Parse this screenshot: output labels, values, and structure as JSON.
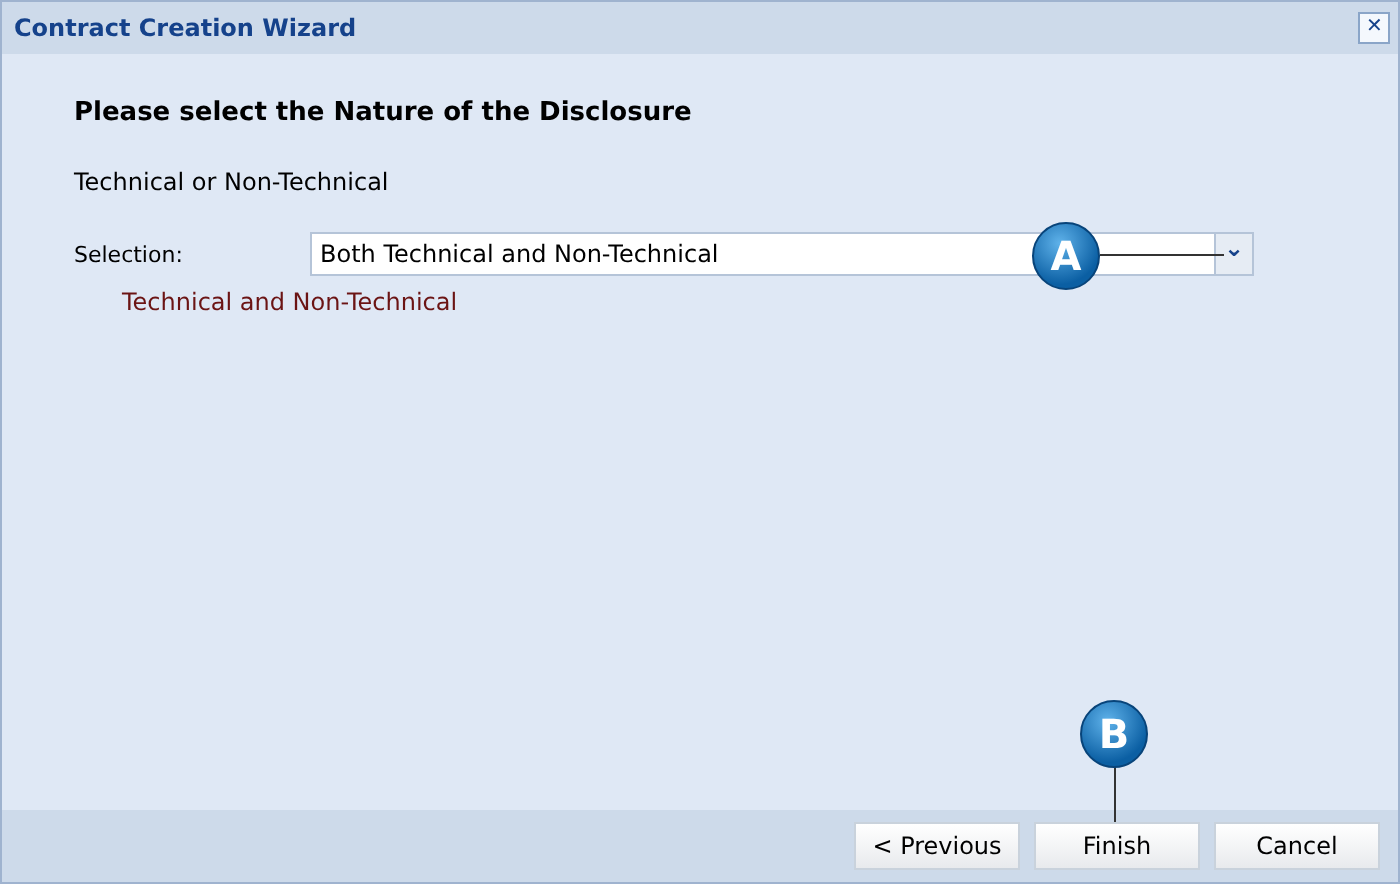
{
  "window": {
    "title": "Contract Creation Wizard",
    "close": "✕"
  },
  "heading": "Please select the Nature of the Disclosure",
  "subheading": "Technical or Non-Technical",
  "selection": {
    "label": "Selection:",
    "value": "Both Technical and Non-Technical",
    "caret": "⌄"
  },
  "description": "Technical and Non-Technical",
  "callouts": [
    {
      "label": "A"
    },
    {
      "label": "B"
    }
  ],
  "buttons": [
    "< Previous",
    "Finish",
    "Cancel"
  ]
}
